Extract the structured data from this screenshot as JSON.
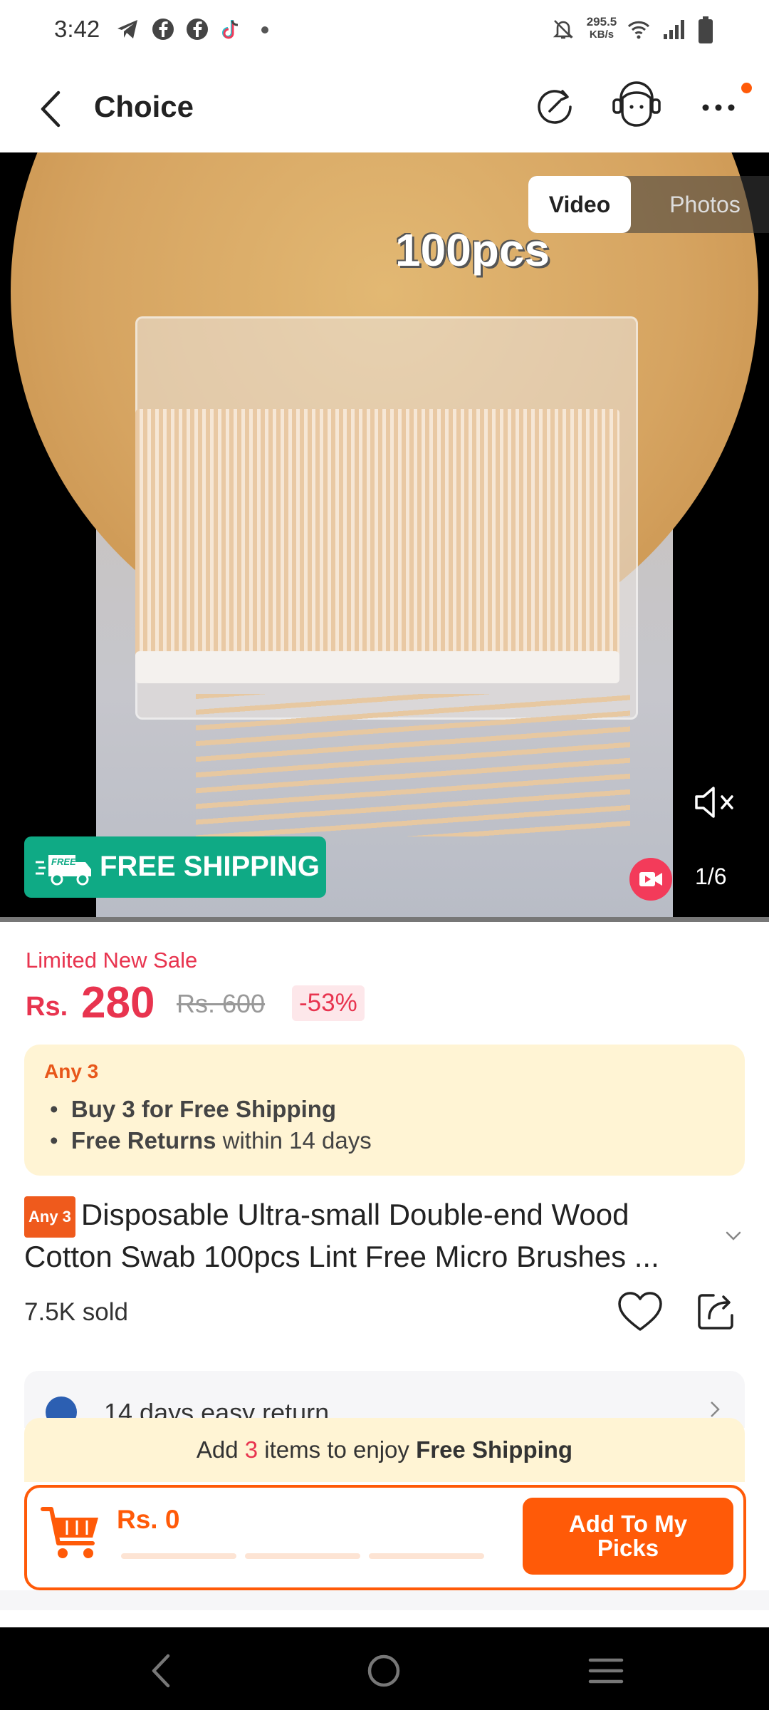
{
  "status_bar": {
    "time": "3:42",
    "net_speed_value": "295.5",
    "net_speed_unit": "KB/s",
    "icons": [
      "telegram-icon",
      "facebook-icon",
      "facebook-icon",
      "tiktok-icon",
      "dot-icon",
      "mute-bell-icon",
      "wifi-icon",
      "signal-icon",
      "battery-icon"
    ]
  },
  "header": {
    "title": "Choice",
    "notification_color": "#ff5a08"
  },
  "media": {
    "overlay_text": "100pcs",
    "tab_video": "Video",
    "tab_photos": "Photos",
    "free_shipping_badge_small": "FREE",
    "free_shipping_label": "FREE SHIPPING",
    "page_indicator": "1/6"
  },
  "price": {
    "sale_label": "Limited New Sale",
    "currency": "Rs.",
    "current": "280",
    "original": "Rs. 600",
    "discount": "-53%"
  },
  "promo": {
    "tag": "Any 3",
    "line1_bold": "Buy 3 for  Free Shipping",
    "line2_bold": "Free Returns",
    "line2_rest": " within 14 days"
  },
  "product": {
    "tag": "Any 3",
    "title": "Disposable Ultra-small Double-end Wood Cotton  Swab 100pcs Lint Free Micro Brushes ...",
    "sold": "7.5K sold"
  },
  "returns": {
    "text": "14 days easy return"
  },
  "cart_banner": {
    "prefix": "Add ",
    "count": "3",
    "middle": " items to enjoy ",
    "bold": "Free Shipping"
  },
  "cart_bar": {
    "price": "Rs. 0",
    "button": "Add To My Picks"
  },
  "colors": {
    "accent": "#ff5a08",
    "price_red": "#e8344f",
    "free_shipping_green": "#0faa85",
    "promo_bg": "#fff4d4"
  }
}
